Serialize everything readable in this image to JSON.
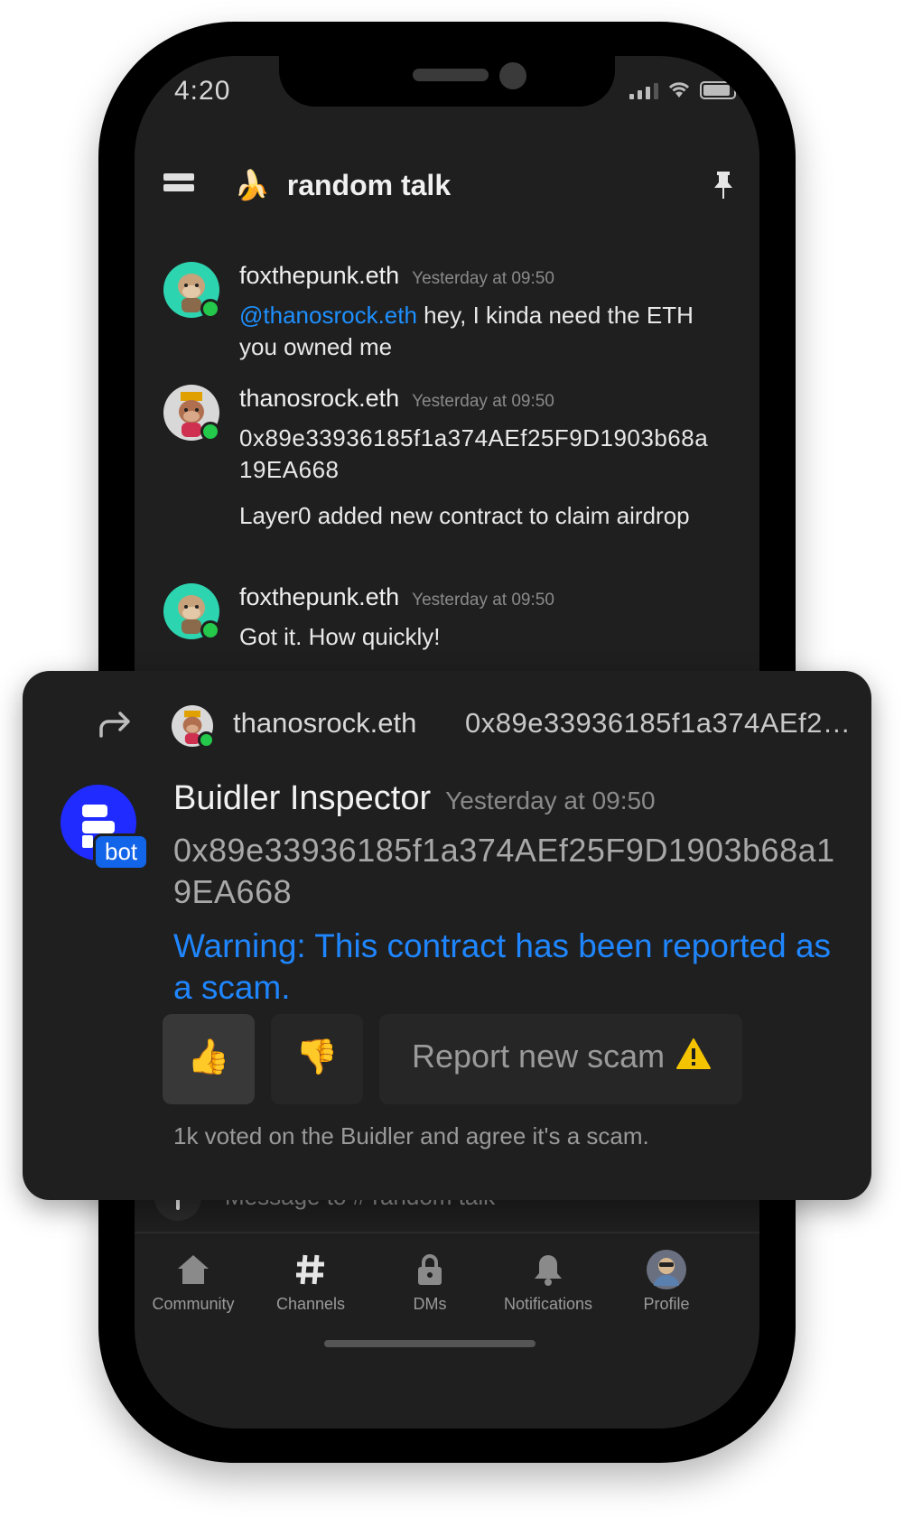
{
  "status_bar": {
    "time": "4:20"
  },
  "header": {
    "channel_emoji": "🍌",
    "channel_title": "random talk"
  },
  "messages": [
    {
      "author": "foxthepunk.eth",
      "time": "Yesterday at 09:50",
      "mention": "@thanosrock.eth",
      "text": " hey, I kinda need the ETH you owned me"
    },
    {
      "author": "thanosrock.eth",
      "time": "Yesterday at 09:50",
      "text": "0x89e33936185f1a374AEf25F9D1903b68a19EA668",
      "text2": "Layer0 added new contract to claim airdrop"
    },
    {
      "author": "foxthepunk.eth",
      "time": "Yesterday at 09:50",
      "text": "Got it. How quickly!"
    }
  ],
  "bot_card": {
    "reply_to": {
      "author": "thanosrock.eth",
      "text": "0x89e33936185f1a374AEf25F9D1903b68a19EA668"
    },
    "bot_name": "Buidler Inspector",
    "bot_badge": "bot",
    "time": "Yesterday at 09:50",
    "address": "0x89e33936185f1a374AEf25F9D1903b68a19EA668",
    "warning": "Warning: This contract has been reported as a scam.",
    "thumbs_up": "👍",
    "thumbs_down": "👎",
    "report_label": "Report new scam",
    "votes_text": "1k voted on the Buidler and agree it's a scam."
  },
  "input": {
    "placeholder": "Message to # random talk"
  },
  "tabs": [
    {
      "label": "Community",
      "icon": "home-icon"
    },
    {
      "label": "Channels",
      "icon": "hash-icon"
    },
    {
      "label": "DMs",
      "icon": "lock-icon"
    },
    {
      "label": "Notifications",
      "icon": "bell-icon"
    },
    {
      "label": "Profile",
      "icon": "profile-avatar"
    }
  ],
  "colors": {
    "background": "#1f1f1f",
    "accent_blue": "#1f86ff",
    "online_green": "#24c84a",
    "bot_blue": "#1f2bff"
  }
}
